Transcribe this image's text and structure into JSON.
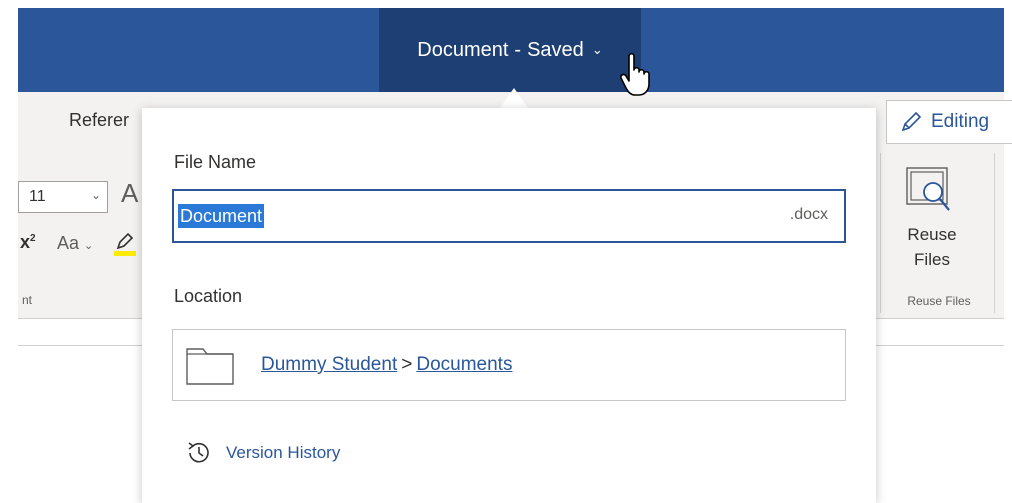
{
  "titlebar": {
    "title": "Document",
    "separator": "-",
    "status": "Saved",
    "chevron": "⌄"
  },
  "ribbon": {
    "tab_partial": "Referer",
    "font_size": "11",
    "grow_font_glyph": "A",
    "superscript_base": "x",
    "superscript_exp": "2",
    "change_case": "Aa",
    "font_group_label": "nt",
    "editing_label": "Editing",
    "reuse_files_line1": "Reuse",
    "reuse_files_line2": "Files",
    "reuse_group_label": "Reuse Files"
  },
  "popup": {
    "file_name_label": "File Name",
    "file_name_value": "Document",
    "file_extension": ".docx",
    "location_label": "Location",
    "location_path": [
      "Dummy Student",
      "Documents"
    ],
    "path_separator": ">",
    "version_history_label": "Version History"
  },
  "colors": {
    "titlebar": "#2b579a",
    "title_button": "#1e3f73",
    "selection": "#2b79d6",
    "link": "#2b579a",
    "highlight": "#ffeb00"
  },
  "icons": [
    "chevron-down-icon",
    "pointer-hand-cursor-icon",
    "pencil-icon",
    "reuse-files-icon",
    "folder-icon",
    "history-icon",
    "highlighter-icon"
  ]
}
